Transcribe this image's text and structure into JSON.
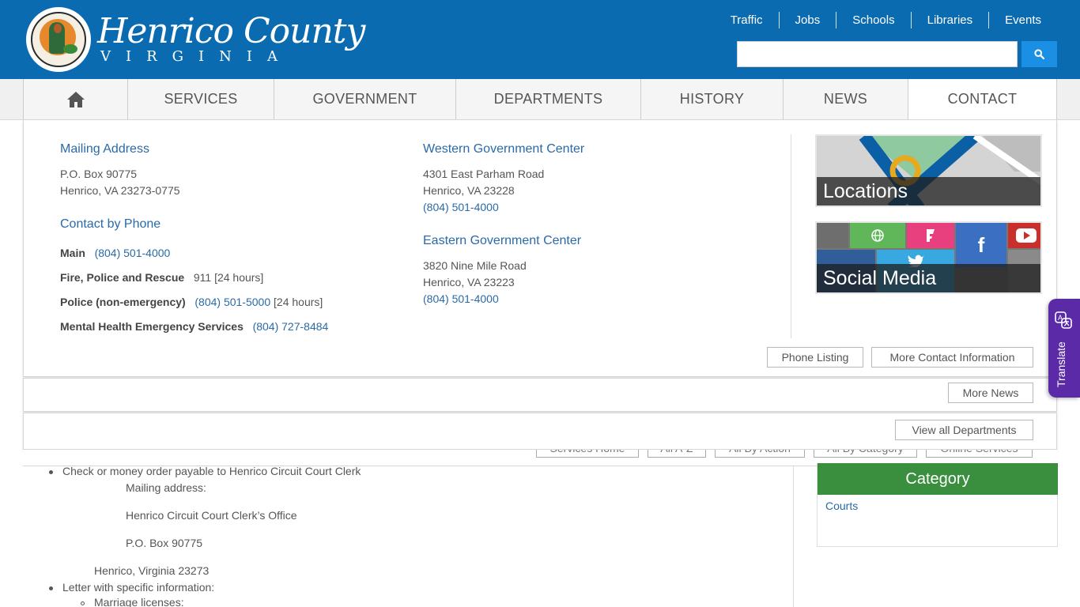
{
  "header": {
    "logo_name": "Henrico County",
    "logo_sub": "VIRGINIA",
    "top_links": [
      "Traffic",
      "Jobs",
      "Schools",
      "Libraries",
      "Events"
    ],
    "search": {
      "placeholder": "",
      "value": ""
    }
  },
  "nav": {
    "items": [
      {
        "label": "",
        "icon": "home-icon"
      },
      {
        "label": "SERVICES"
      },
      {
        "label": "GOVERNMENT"
      },
      {
        "label": "DEPARTMENTS"
      },
      {
        "label": "HISTORY"
      },
      {
        "label": "NEWS"
      },
      {
        "label": "CONTACT"
      }
    ]
  },
  "contact": {
    "mailing": {
      "title": "Mailing Address",
      "line1": "P.O. Box 90775",
      "line2": "Henrico, VA 23273-0775"
    },
    "phone": {
      "title": "Contact by Phone",
      "rows": [
        {
          "label": "Main",
          "number": "(804) 501-4000",
          "note": ""
        },
        {
          "label": "Fire, Police and Rescue",
          "number": "911",
          "note": "[24 hours]"
        },
        {
          "label": "Police (non-emergency)",
          "number": "(804) 501-5000",
          "note": "[24 hours]"
        },
        {
          "label": "Mental Health Emergency Services",
          "number": "(804) 727-8484",
          "note": ""
        }
      ]
    },
    "western": {
      "title": "Western Government Center",
      "line1": "4301 East Parham Road",
      "line2": "Henrico, VA 23228",
      "phone": "(804) 501-4000"
    },
    "eastern": {
      "title": "Eastern Government Center",
      "line1": "3820 Nine Mile Road",
      "line2": "Henrico, VA 23223",
      "phone": "(804) 501-4000"
    },
    "tiles": {
      "locations": "Locations",
      "social": "Social Media"
    },
    "buttons": {
      "phone_listing": "Phone Listing",
      "more_contact": "More Contact Information"
    }
  },
  "news_panel": {
    "more_news": "More News"
  },
  "departments_panel": {
    "view_all": "View all Departments"
  },
  "services_peek": [
    "Services Home",
    "All A-Z",
    "All By Action",
    "All By Category",
    "Online Services"
  ],
  "content": {
    "bullet1": "Check or money order payable to Henrico Circuit Court Clerk",
    "mail_label": "Mailing address:",
    "office": "Henrico Circuit Court Clerk’s Office",
    "box": "P.O. Box 90775",
    "city": "Henrico, Virginia 23273",
    "bullet2": "Letter with specific information:",
    "sub1": "Marriage licenses:"
  },
  "category": {
    "title": "Category",
    "link": "Courts"
  },
  "translate": {
    "label": "Translate"
  },
  "colors": {
    "header_blue": "#0b6bb0",
    "link_blue": "#2a6aa8",
    "category_green": "#3a8f3f",
    "translate_purple": "#5b2aa6"
  }
}
